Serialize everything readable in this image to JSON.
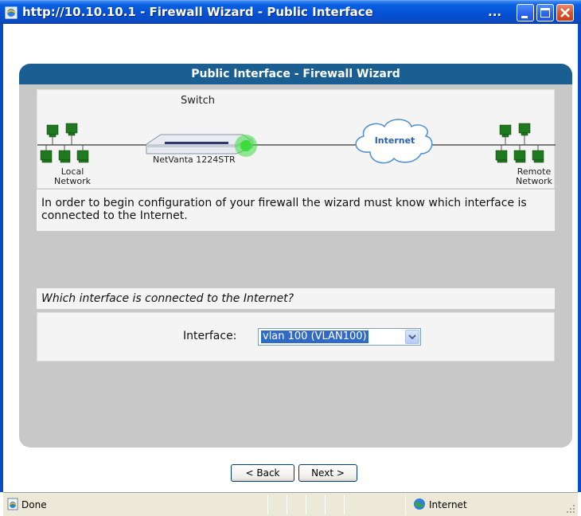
{
  "window": {
    "title": "http://10.10.10.1 - Firewall Wizard - Public Interface",
    "title_ellipsis": "..."
  },
  "panel": {
    "header": "Public Interface - Firewall Wizard"
  },
  "diagram": {
    "switch_label": "Switch",
    "device_label": "NetVanta 1224STR",
    "cloud_label": "Internet",
    "local_label_line1": "Local",
    "local_label_line2": "Network",
    "remote_label_line1": "Remote",
    "remote_label_line2": "Network",
    "led_color": "#3ddc3d"
  },
  "info": {
    "text": "In order to begin configuration of your firewall the wizard must know which interface is connected to the Internet."
  },
  "question": {
    "text": "Which interface is connected to the Internet?"
  },
  "interface_field": {
    "label": "Interface:",
    "selected": "vlan 100 (VLAN100)"
  },
  "nav": {
    "back_label": "< Back",
    "next_label": "Next >"
  },
  "statusbar": {
    "status": "Done",
    "zone": "Internet"
  },
  "colors": {
    "panel_header": "#1b5f92",
    "panel_body": "#c8c8c8",
    "titlebar": "#0551d6",
    "selection": "#316ac5"
  }
}
